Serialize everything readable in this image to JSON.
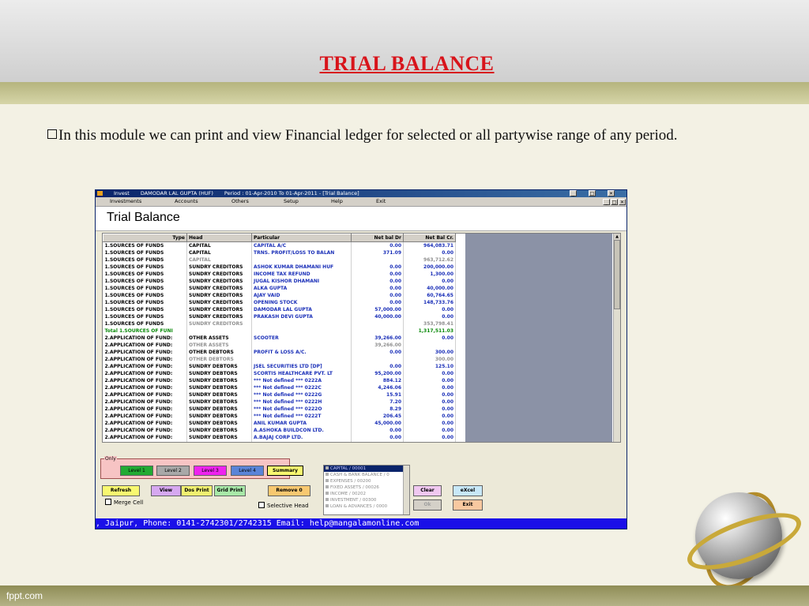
{
  "slide": {
    "title": "TRIAL BALANCE",
    "bullet": "In this module we can print and view Financial ledger for selected or all partywise range of any period.",
    "footer_brand": "fppt.com"
  },
  "window": {
    "app_name": "Invest",
    "company": "DAMODAR LAL GUPTA (HUF)",
    "period": "Period : 01-Apr-2010  To  01-Apr-2011 - [Trial Balance]",
    "controls": [
      "_",
      "□",
      "✕"
    ]
  },
  "menu": [
    "Investments",
    "Accounts",
    "Others",
    "Setup",
    "Help",
    "Exit"
  ],
  "form_title": "Trial Balance",
  "grid": {
    "columns": [
      "Type",
      "Head",
      "Particular",
      "Net bal Dr",
      "Net Bal Cr."
    ],
    "rows": [
      {
        "type": "1.SOURCES OF FUNDS",
        "head": "CAPITAL",
        "particular": "CAPITAL A/C",
        "dr": "0.00",
        "cr": "964,083.71",
        "style": "normal"
      },
      {
        "type": "1.SOURCES OF FUNDS",
        "head": "CAPITAL",
        "particular": "TRNS. PROFIT/LOSS TO BALAN",
        "dr": "371.09",
        "cr": "0.00",
        "style": "normal"
      },
      {
        "type": "1.SOURCES OF FUNDS",
        "head": "CAPITAL",
        "particular": "",
        "dr": "",
        "cr": "963,712.62",
        "style": "subtotal"
      },
      {
        "type": "1.SOURCES OF FUNDS",
        "head": "SUNDRY CREDITORS",
        "particular": "ASHOK KUMAR DHAMANI HUF",
        "dr": "0.00",
        "cr": "200,000.00",
        "style": "normal"
      },
      {
        "type": "1.SOURCES OF FUNDS",
        "head": "SUNDRY CREDITORS",
        "particular": "INCOME TAX REFUND",
        "dr": "0.00",
        "cr": "1,300.00",
        "style": "normal"
      },
      {
        "type": "1.SOURCES OF FUNDS",
        "head": "SUNDRY CREDITORS",
        "particular": "JUGAL KISHOR DHAMANI",
        "dr": "0.00",
        "cr": "0.00",
        "style": "normal"
      },
      {
        "type": "1.SOURCES OF FUNDS",
        "head": "SUNDRY CREDITORS",
        "particular": "ALKA GUPTA",
        "dr": "0.00",
        "cr": "40,000.00",
        "style": "normal"
      },
      {
        "type": "1.SOURCES OF FUNDS",
        "head": "SUNDRY CREDITORS",
        "particular": "AJAY VAID",
        "dr": "0.00",
        "cr": "60,764.65",
        "style": "normal"
      },
      {
        "type": "1.SOURCES OF FUNDS",
        "head": "SUNDRY CREDITORS",
        "particular": "OPENING STOCK",
        "dr": "0.00",
        "cr": "148,733.76",
        "style": "normal"
      },
      {
        "type": "1.SOURCES OF FUNDS",
        "head": "SUNDRY CREDITORS",
        "particular": "DAMODAR LAL GUPTA",
        "dr": "57,000.00",
        "cr": "0.00",
        "style": "normal"
      },
      {
        "type": "1.SOURCES OF FUNDS",
        "head": "SUNDRY CREDITORS",
        "particular": "PRAKASH DEVI GUPTA",
        "dr": "40,000.00",
        "cr": "0.00",
        "style": "normal"
      },
      {
        "type": "1.SOURCES OF FUNDS",
        "head": "SUNDRY CREDITORS",
        "particular": "",
        "dr": "",
        "cr": "353,798.41",
        "style": "subtotal"
      },
      {
        "type": "Total 1.SOURCES OF FUNI",
        "head": "",
        "particular": "",
        "dr": "",
        "cr": "1,317,511.03",
        "style": "total"
      },
      {
        "type": "2.APPLICATION OF FUND:",
        "head": "OTHER ASSETS",
        "particular": "SCOOTER",
        "dr": "39,266.00",
        "cr": "0.00",
        "style": "normal"
      },
      {
        "type": "2.APPLICATION OF FUND:",
        "head": "OTHER ASSETS",
        "particular": "",
        "dr": "39,266.00",
        "cr": "",
        "style": "subtotal"
      },
      {
        "type": "2.APPLICATION OF FUND:",
        "head": "OTHER DEBTORS",
        "particular": "PROFIT & LOSS A/C.",
        "dr": "0.00",
        "cr": "300.00",
        "style": "normal"
      },
      {
        "type": "2.APPLICATION OF FUND:",
        "head": "OTHER DEBTORS",
        "particular": "",
        "dr": "",
        "cr": "300.00",
        "style": "subtotal"
      },
      {
        "type": "2.APPLICATION OF FUND:",
        "head": "SUNDRY DEBTORS",
        "particular": "JSEL SECURITIES LTD [DP]",
        "dr": "0.00",
        "cr": "125.10",
        "style": "normal"
      },
      {
        "type": "2.APPLICATION OF FUND:",
        "head": "SUNDRY DEBTORS",
        "particular": "SCORTIS HEALTHCARE PVT. LT",
        "dr": "95,200.00",
        "cr": "0.00",
        "style": "normal"
      },
      {
        "type": "2.APPLICATION OF FUND:",
        "head": "SUNDRY DEBTORS",
        "particular": "*** Not defined *** 0222A",
        "dr": "884.12",
        "cr": "0.00",
        "style": "normal"
      },
      {
        "type": "2.APPLICATION OF FUND:",
        "head": "SUNDRY DEBTORS",
        "particular": "*** Not defined *** 0222C",
        "dr": "4,246.06",
        "cr": "0.00",
        "style": "normal"
      },
      {
        "type": "2.APPLICATION OF FUND:",
        "head": "SUNDRY DEBTORS",
        "particular": "*** Not defined *** 0222G",
        "dr": "15.91",
        "cr": "0.00",
        "style": "normal"
      },
      {
        "type": "2.APPLICATION OF FUND:",
        "head": "SUNDRY DEBTORS",
        "particular": "*** Not defined *** 0222H",
        "dr": "7.20",
        "cr": "0.00",
        "style": "normal"
      },
      {
        "type": "2.APPLICATION OF FUND:",
        "head": "SUNDRY DEBTORS",
        "particular": "*** Not defined *** 0222O",
        "dr": "8.29",
        "cr": "0.00",
        "style": "normal"
      },
      {
        "type": "2.APPLICATION OF FUND:",
        "head": "SUNDRY DEBTORS",
        "particular": "*** Not defined *** 0222T",
        "dr": "206.45",
        "cr": "0.00",
        "style": "normal"
      },
      {
        "type": "2.APPLICATION OF FUND:",
        "head": "SUNDRY DEBTORS",
        "particular": "ANIL KUMAR GUPTA",
        "dr": "45,000.00",
        "cr": "0.00",
        "style": "normal"
      },
      {
        "type": "2.APPLICATION OF FUND:",
        "head": "SUNDRY DEBTORS",
        "particular": "A.ASHOKA BUILDCON LTD.",
        "dr": "0.00",
        "cr": "0.00",
        "style": "normal"
      },
      {
        "type": "2.APPLICATION OF FUND:",
        "head": "SUNDRY DEBTORS",
        "particular": "A.BAJAJ CORP LTD.",
        "dr": "0.00",
        "cr": "0.00",
        "style": "normal"
      },
      {
        "type": "2.APPLICATION OF FUND:",
        "head": "SUNDRY DEBTORS",
        "particular": "A.COAL INDIA LTD.",
        "dr": "0.00",
        "cr": "0.00",
        "style": "normal"
      }
    ]
  },
  "controls": {
    "only_label": "Only",
    "level1": "Level 1",
    "level2": "Level 2",
    "level3": "Level 3",
    "level4": "Level 4",
    "summary": "Summary",
    "refresh": "Refresh",
    "view": "View",
    "dos_print": "Dos Print",
    "grid_print": "Grid Print",
    "remove": "Remove 0",
    "merge_cell": "Merge Cell",
    "selective_head": "Selective Head",
    "clear": "Clear",
    "ok": "Ok",
    "excel": "eXcel",
    "exit": "Exit"
  },
  "list_items": [
    "CAPITAL / 00001",
    "CASH & BANK BALANCE / 0",
    "EXPENSES / 00200",
    "FIXED ASSETS / 00026",
    "INCOME / 00202",
    "INVESTMENT / 00300",
    "LOAN & ADVANCES / 0000"
  ],
  "status": ", Jaipur, Phone: 0141-2742301/2742315 Email: help@mangalamonline.com",
  "colors": {
    "title_red": "#d8141b",
    "status_blue": "#1a10e8",
    "level1_green": "#22aa33",
    "level2_gray": "#a8a8a8",
    "level3_magenta": "#ee22ee",
    "level4_blue": "#5a84d8",
    "summary_yellow": "#f8f870",
    "grid_blue_text": "#1a2fb8"
  }
}
